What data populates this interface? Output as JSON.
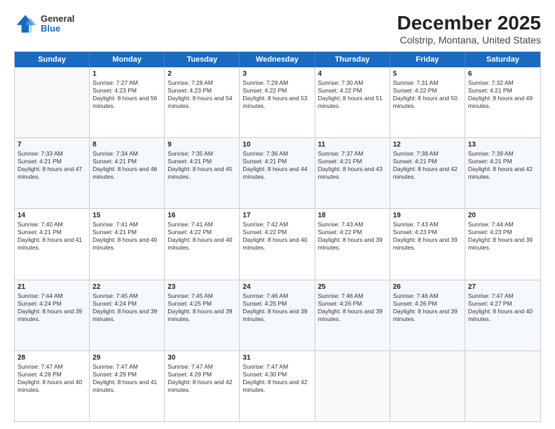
{
  "logo": {
    "general": "General",
    "blue": "Blue"
  },
  "title": "December 2025",
  "subtitle": "Colstrip, Montana, United States",
  "days": [
    "Sunday",
    "Monday",
    "Tuesday",
    "Wednesday",
    "Thursday",
    "Friday",
    "Saturday"
  ],
  "rows": [
    [
      {
        "day": "",
        "empty": true
      },
      {
        "day": "1",
        "sunrise": "7:27 AM",
        "sunset": "4:23 PM",
        "daylight": "8 hours and 56 minutes."
      },
      {
        "day": "2",
        "sunrise": "7:28 AM",
        "sunset": "4:23 PM",
        "daylight": "8 hours and 54 minutes."
      },
      {
        "day": "3",
        "sunrise": "7:29 AM",
        "sunset": "4:22 PM",
        "daylight": "8 hours and 53 minutes."
      },
      {
        "day": "4",
        "sunrise": "7:30 AM",
        "sunset": "4:22 PM",
        "daylight": "8 hours and 51 minutes."
      },
      {
        "day": "5",
        "sunrise": "7:31 AM",
        "sunset": "4:22 PM",
        "daylight": "8 hours and 50 minutes."
      },
      {
        "day": "6",
        "sunrise": "7:32 AM",
        "sunset": "4:21 PM",
        "daylight": "8 hours and 49 minutes."
      }
    ],
    [
      {
        "day": "7",
        "sunrise": "7:33 AM",
        "sunset": "4:21 PM",
        "daylight": "8 hours and 47 minutes."
      },
      {
        "day": "8",
        "sunrise": "7:34 AM",
        "sunset": "4:21 PM",
        "daylight": "8 hours and 46 minutes."
      },
      {
        "day": "9",
        "sunrise": "7:35 AM",
        "sunset": "4:21 PM",
        "daylight": "8 hours and 45 minutes."
      },
      {
        "day": "10",
        "sunrise": "7:36 AM",
        "sunset": "4:21 PM",
        "daylight": "8 hours and 44 minutes."
      },
      {
        "day": "11",
        "sunrise": "7:37 AM",
        "sunset": "4:21 PM",
        "daylight": "8 hours and 43 minutes."
      },
      {
        "day": "12",
        "sunrise": "7:38 AM",
        "sunset": "4:21 PM",
        "daylight": "8 hours and 42 minutes."
      },
      {
        "day": "13",
        "sunrise": "7:39 AM",
        "sunset": "4:21 PM",
        "daylight": "8 hours and 42 minutes."
      }
    ],
    [
      {
        "day": "14",
        "sunrise": "7:40 AM",
        "sunset": "4:21 PM",
        "daylight": "8 hours and 41 minutes."
      },
      {
        "day": "15",
        "sunrise": "7:41 AM",
        "sunset": "4:21 PM",
        "daylight": "8 hours and 40 minutes."
      },
      {
        "day": "16",
        "sunrise": "7:41 AM",
        "sunset": "4:22 PM",
        "daylight": "8 hours and 40 minutes."
      },
      {
        "day": "17",
        "sunrise": "7:42 AM",
        "sunset": "4:22 PM",
        "daylight": "8 hours and 40 minutes."
      },
      {
        "day": "18",
        "sunrise": "7:43 AM",
        "sunset": "4:22 PM",
        "daylight": "8 hours and 39 minutes."
      },
      {
        "day": "19",
        "sunrise": "7:43 AM",
        "sunset": "4:23 PM",
        "daylight": "8 hours and 39 minutes."
      },
      {
        "day": "20",
        "sunrise": "7:44 AM",
        "sunset": "4:23 PM",
        "daylight": "8 hours and 39 minutes."
      }
    ],
    [
      {
        "day": "21",
        "sunrise": "7:44 AM",
        "sunset": "4:24 PM",
        "daylight": "8 hours and 39 minutes."
      },
      {
        "day": "22",
        "sunrise": "7:45 AM",
        "sunset": "4:24 PM",
        "daylight": "8 hours and 39 minutes."
      },
      {
        "day": "23",
        "sunrise": "7:45 AM",
        "sunset": "4:25 PM",
        "daylight": "8 hours and 39 minutes."
      },
      {
        "day": "24",
        "sunrise": "7:46 AM",
        "sunset": "4:25 PM",
        "daylight": "8 hours and 39 minutes."
      },
      {
        "day": "25",
        "sunrise": "7:46 AM",
        "sunset": "4:26 PM",
        "daylight": "8 hours and 39 minutes."
      },
      {
        "day": "26",
        "sunrise": "7:46 AM",
        "sunset": "4:26 PM",
        "daylight": "8 hours and 39 minutes."
      },
      {
        "day": "27",
        "sunrise": "7:47 AM",
        "sunset": "4:27 PM",
        "daylight": "8 hours and 40 minutes."
      }
    ],
    [
      {
        "day": "28",
        "sunrise": "7:47 AM",
        "sunset": "4:28 PM",
        "daylight": "8 hours and 40 minutes."
      },
      {
        "day": "29",
        "sunrise": "7:47 AM",
        "sunset": "4:29 PM",
        "daylight": "8 hours and 41 minutes."
      },
      {
        "day": "30",
        "sunrise": "7:47 AM",
        "sunset": "4:29 PM",
        "daylight": "8 hours and 42 minutes."
      },
      {
        "day": "31",
        "sunrise": "7:47 AM",
        "sunset": "4:30 PM",
        "daylight": "8 hours and 42 minutes."
      },
      {
        "day": "",
        "empty": true
      },
      {
        "day": "",
        "empty": true
      },
      {
        "day": "",
        "empty": true
      }
    ]
  ]
}
